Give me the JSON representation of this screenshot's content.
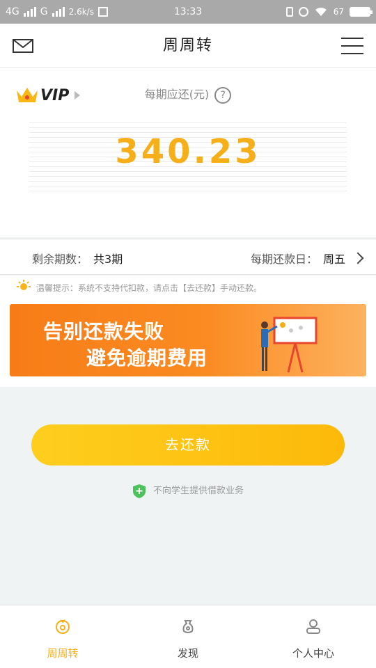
{
  "status_bar": {
    "network_1": "4G",
    "network_2": "G",
    "speed": "2.6k/s",
    "time": "13:33",
    "battery_percent": "67"
  },
  "header": {
    "title": "周周转"
  },
  "card": {
    "vip_label": "VIP",
    "per_period_label": "每期应还(元)",
    "help_symbol": "?",
    "amount": "340.23"
  },
  "info_row": {
    "remaining_label": "剩余期数：",
    "remaining_value": "共3期",
    "due_day_label": "每期还款日：",
    "due_day_value": "周五"
  },
  "tip": {
    "text": "温馨提示：系统不支持代扣款，请点击【去还款】手动还款。"
  },
  "banner": {
    "line1": "告别还款失败",
    "line2": "避免逾期费用"
  },
  "repay_button": {
    "label": "去还款"
  },
  "notice": {
    "text": "不向学生提供借款业务"
  },
  "tabbar": {
    "tabs": [
      {
        "label": "周周转",
        "icon": "wallet-icon",
        "active": true
      },
      {
        "label": "发现",
        "icon": "discover-icon",
        "active": false
      },
      {
        "label": "个人中心",
        "icon": "user-icon",
        "active": false
      }
    ]
  },
  "colors": {
    "accent": "#f6ae19",
    "button": "#fdc014",
    "banner": "#f77c17",
    "shield": "#4cc25a"
  }
}
